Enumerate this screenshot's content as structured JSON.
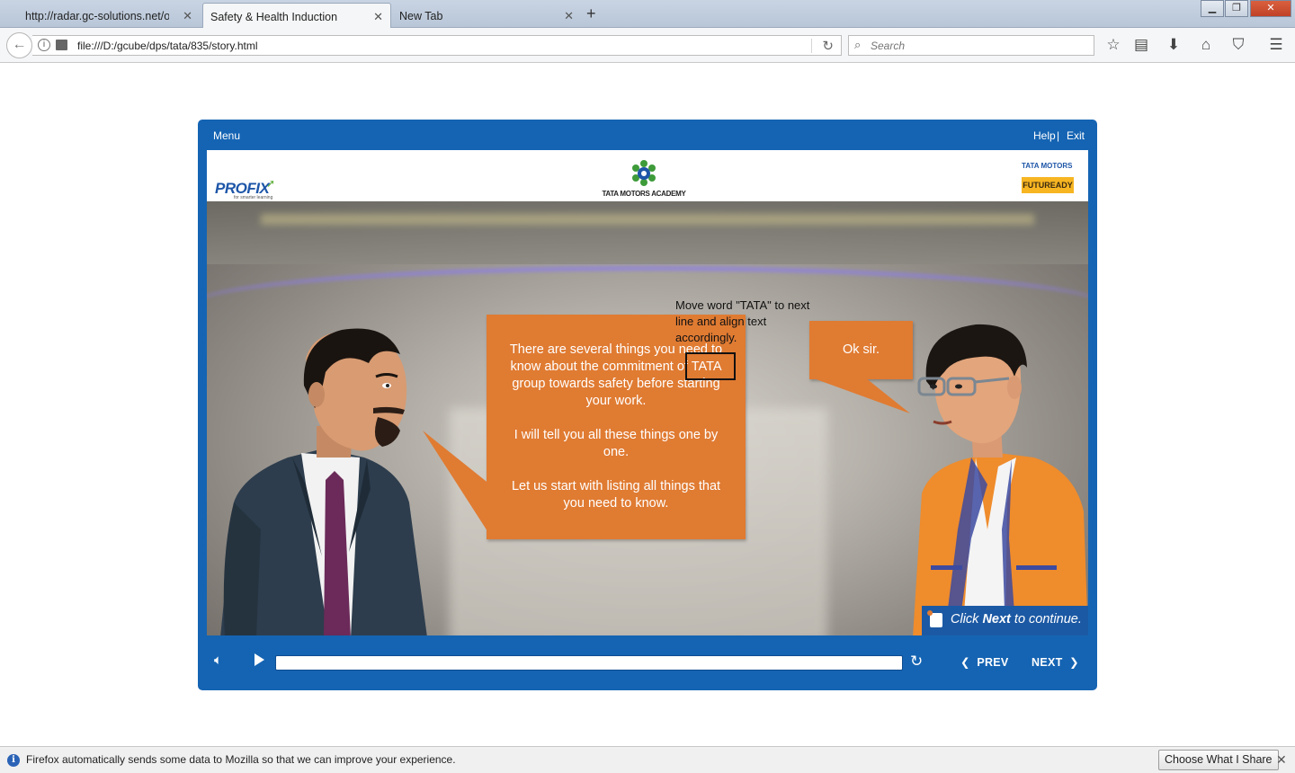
{
  "browser": {
    "tabs": [
      {
        "label": "http://radar.gc-solutions.net/ope",
        "active": false
      },
      {
        "label": "Safety & Health Induction",
        "active": true
      },
      {
        "label": "New Tab",
        "active": false
      }
    ],
    "url": "file:///D:/gcube/dps/tata/835/story.html",
    "search_placeholder": "Search",
    "icons": [
      "back-icon",
      "info-icon",
      "reload-icon",
      "search-icon",
      "bookmark-star-icon",
      "reading-list-icon",
      "download-icon",
      "home-icon",
      "pocket-icon",
      "hamburger-menu-icon"
    ]
  },
  "player": {
    "menu_label": "Menu",
    "help_label": "Help",
    "separator": "|",
    "exit_label": "Exit",
    "header": {
      "left_logo": "PROFIX",
      "left_logo_tagline": "for smarter learning",
      "center_logo": "TATA MOTORS ACADEMY",
      "right_logo_top": "TATA MOTORS",
      "right_logo_bottom": "FUTUREADY"
    },
    "speech_main": "There are several things you need to know about the commitment of TATA group towards safety before starting your work.\n\nI will tell you all these things one by one.\n\nLet us start with listing all things that you need to know.",
    "speech_reply": "Ok sir.",
    "annotation": "Move word \"TATA\" to next line and align text accordingly.",
    "hint_prefix": "Click ",
    "hint_bold": "Next",
    "hint_suffix": " to continue.",
    "controls": {
      "prev_label": "PREV",
      "next_label": "NEXT",
      "progress": 0.0
    }
  },
  "notification": {
    "text": "Firefox automatically sends some data to Mozilla so that we can improve your experience.",
    "button_label": "Choose What I Share"
  },
  "colors": {
    "player_blue": "#1564b3",
    "bubble_orange": "#e07b32",
    "hint_blue": "#1c59a4"
  }
}
